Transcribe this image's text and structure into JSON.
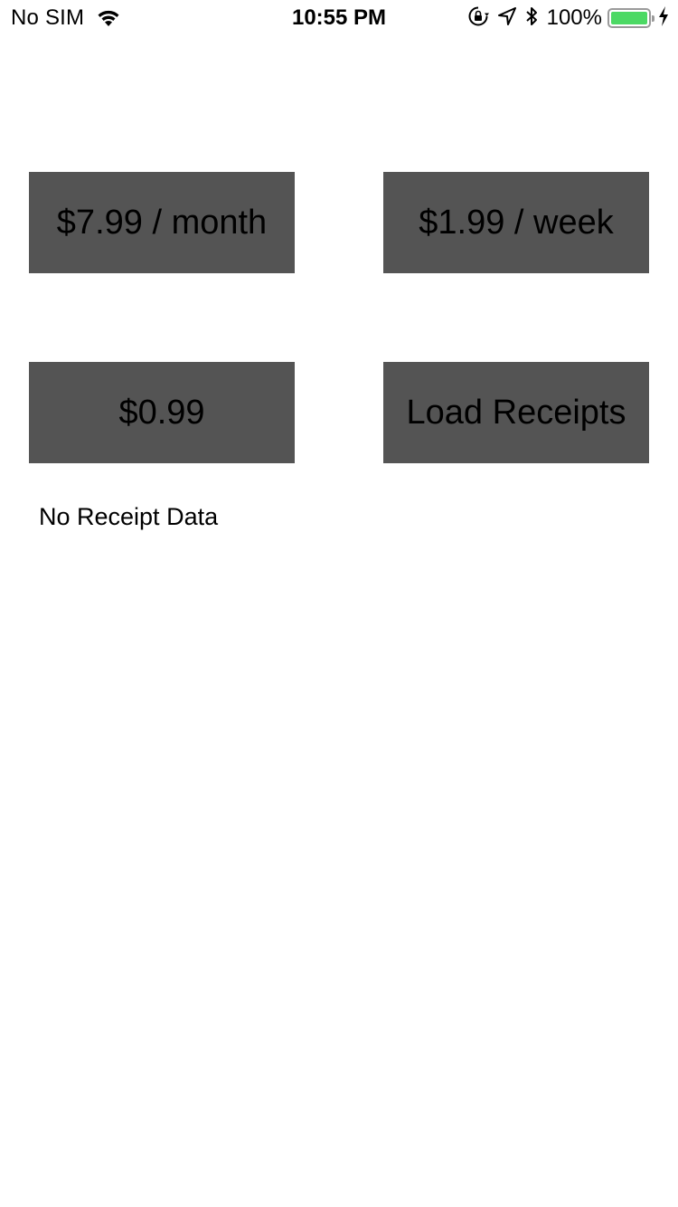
{
  "status_bar": {
    "carrier": "No SIM",
    "time": "10:55 PM",
    "battery_percent": "100%",
    "battery_level": 1.0,
    "battery_color": "#4cd964",
    "icons": [
      "wifi-icon",
      "orientation-lock-icon",
      "location-arrow-icon",
      "bluetooth-icon",
      "battery-icon",
      "charging-bolt-icon"
    ]
  },
  "buttons": {
    "monthly_label": "$7.99 / month",
    "weekly_label": "$1.99 / week",
    "single_label": "$0.99",
    "load_receipts_label": "Load Receipts",
    "background_color": "#545454"
  },
  "receipt": {
    "status_text": "No Receipt Data"
  }
}
